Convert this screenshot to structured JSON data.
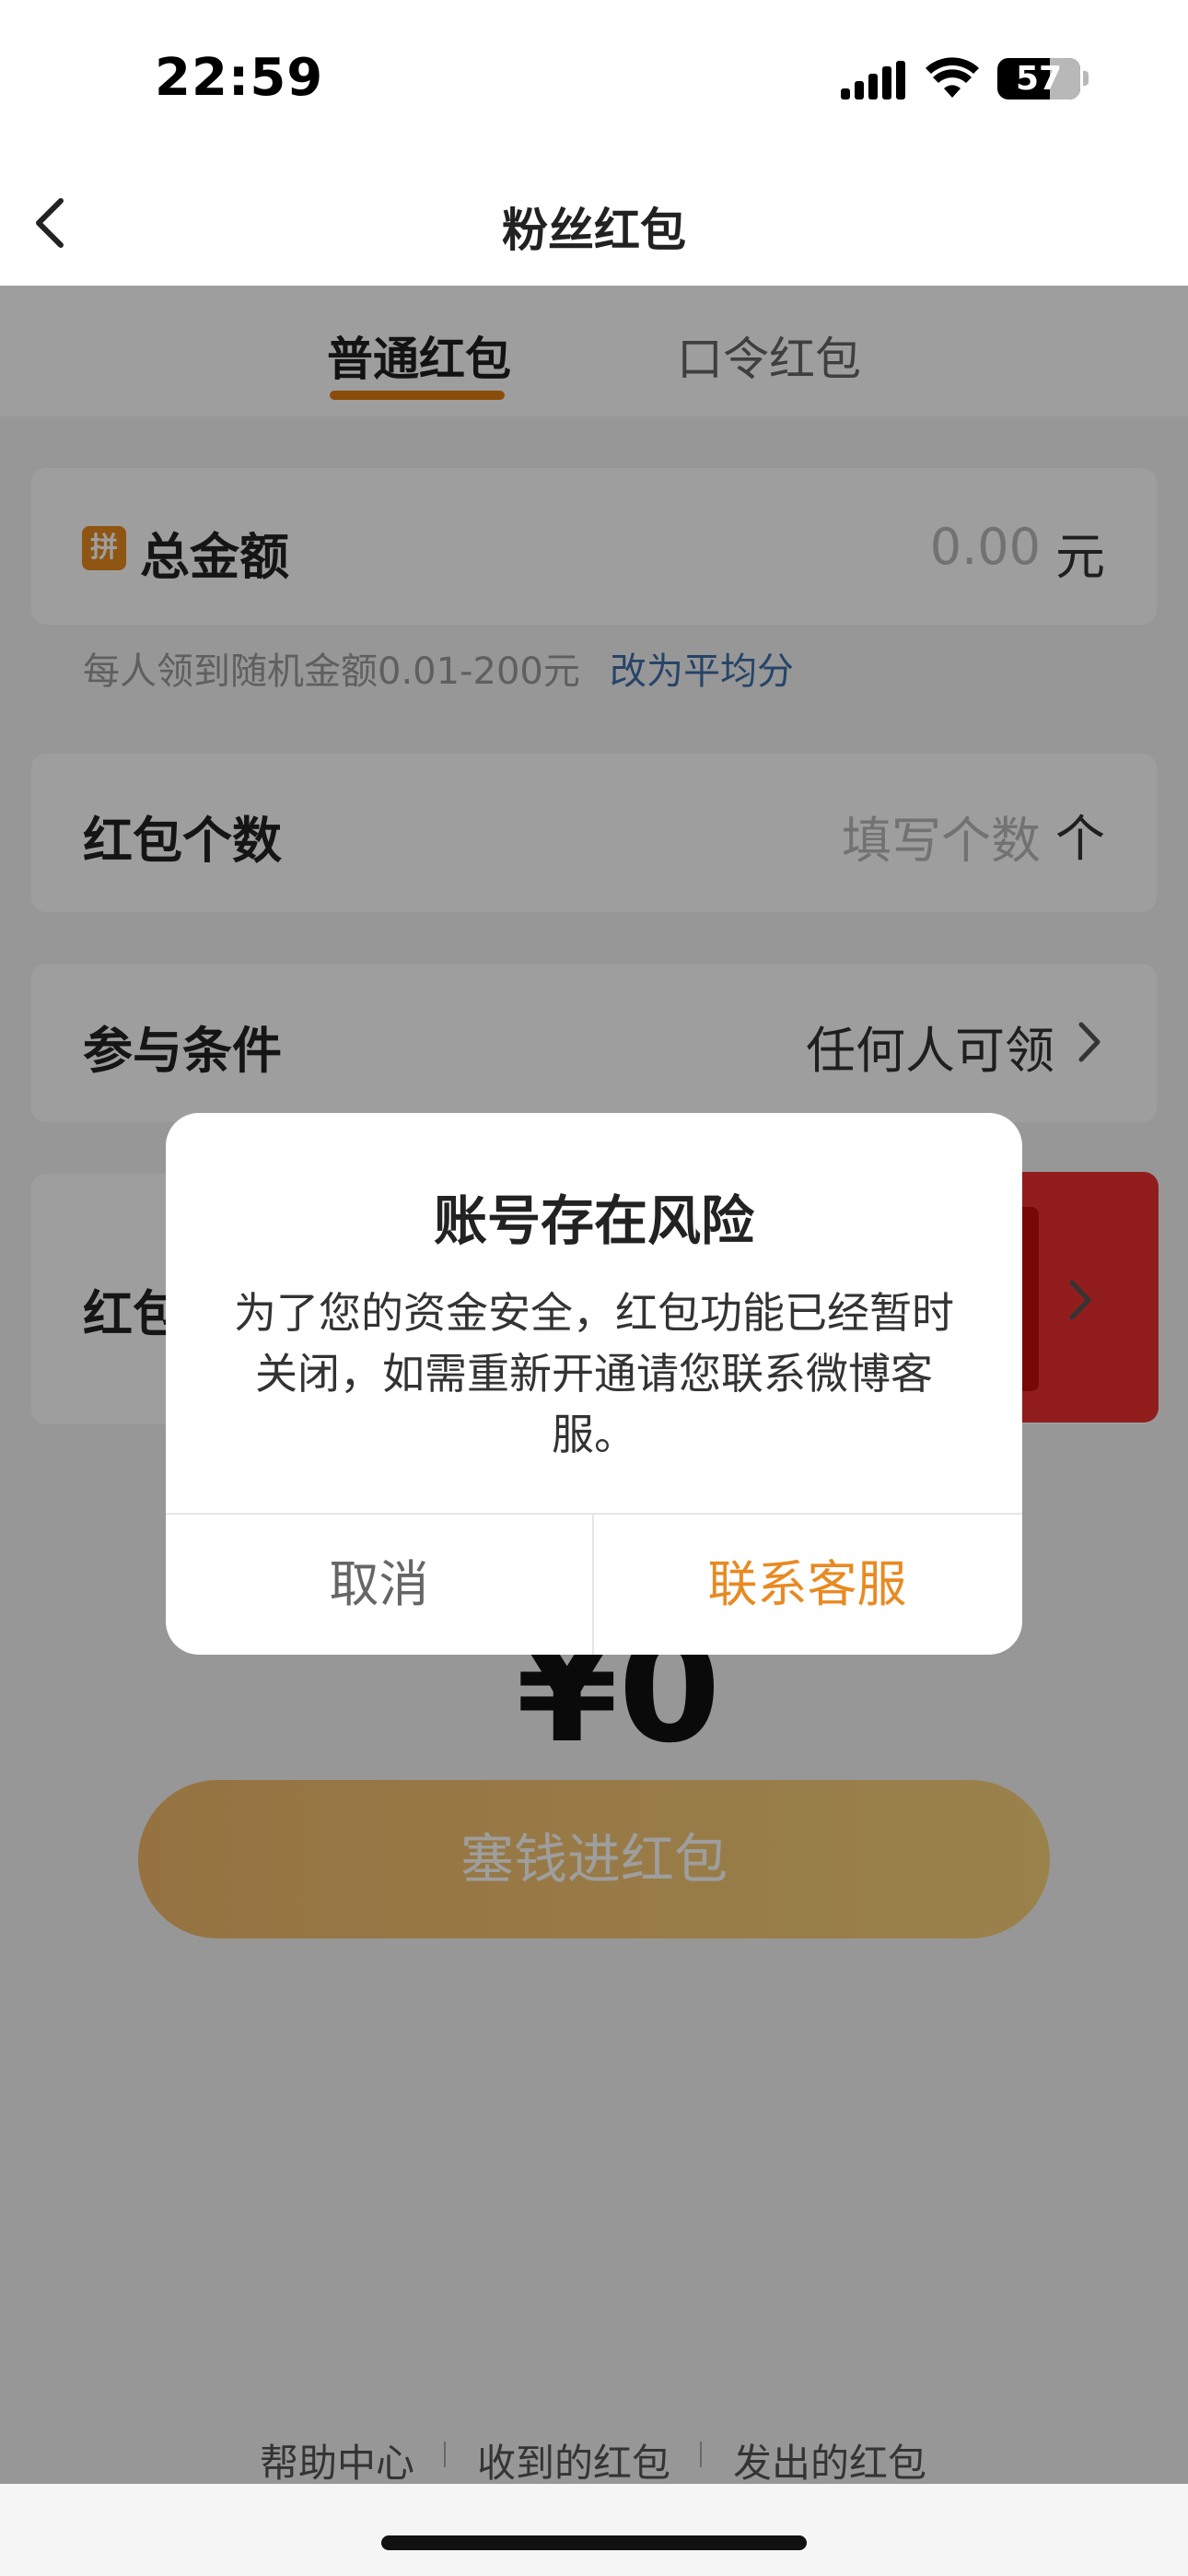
{
  "status_bar": {
    "time": "22:59",
    "battery_level": "57"
  },
  "nav": {
    "title": "粉丝红包"
  },
  "tabs": {
    "active": "普通红包",
    "inactive": "口令红包"
  },
  "amount_card": {
    "badge": "拼",
    "label": "总金额",
    "value": "0.00",
    "unit": "元"
  },
  "hint": {
    "text": "每人领到随机金额0.01-200元",
    "link": "改为平均分"
  },
  "count_card": {
    "label": "红包个数",
    "placeholder": "填写个数",
    "unit": "个"
  },
  "condition_card": {
    "label": "参与条件",
    "value": "任何人可领"
  },
  "cover_card": {
    "label": "红包"
  },
  "big_amount": "¥0",
  "cta_button": "塞钱进红包",
  "footer": {
    "item1": "帮助中心",
    "item2": "收到的红包",
    "item3": "发出的红包"
  },
  "dialog": {
    "title": "账号存在风险",
    "message": "为了您的资金安全，红包功能已经暂时关闭，如需重新开通请您联系微博客服。",
    "cancel": "取消",
    "confirm": "联系客服"
  },
  "colors": {
    "accent": "#e88a22",
    "link": "#3e6fa8",
    "tab_underline": "#e07a10",
    "overlay": "rgba(0,0,0,0.38)"
  }
}
